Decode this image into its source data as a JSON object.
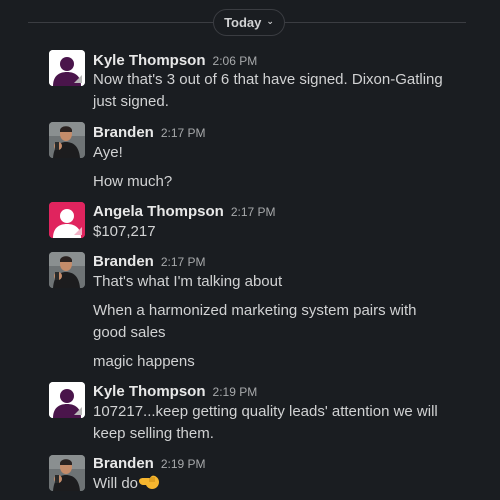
{
  "divider": {
    "label": "Today"
  },
  "messages": [
    {
      "author": "Kyle Thompson",
      "time": "2:06 PM",
      "lines": [
        "Now that's 3 out of 6 that have signed. Dixon-Gatling just signed."
      ]
    },
    {
      "author": "Branden",
      "time": "2:17 PM",
      "lines": [
        "Aye!",
        "How much?"
      ]
    },
    {
      "author": "Angela Thompson",
      "time": "2:17 PM",
      "lines": [
        "$107,217"
      ]
    },
    {
      "author": "Branden",
      "time": "2:17 PM",
      "lines": [
        "That's what I'm talking about",
        "When a harmonized marketing system pairs with good sales",
        "magic happens"
      ]
    },
    {
      "author": "Kyle Thompson",
      "time": "2:19 PM",
      "lines": [
        "107217...keep getting quality leads' attention we will keep selling them."
      ]
    },
    {
      "author": "Branden",
      "time": "2:19 PM",
      "lines": [
        "Will do"
      ]
    }
  ],
  "icons": {
    "chevron": "chevron-down-icon",
    "emoji": "backhand-index-pointing-left-emoji"
  },
  "colors": {
    "background": "#1a1d21",
    "text": "#d1d2d3",
    "timestamp": "#a7a9ab",
    "avatar_purple": "#4a154b",
    "avatar_red": "#e0245e"
  }
}
